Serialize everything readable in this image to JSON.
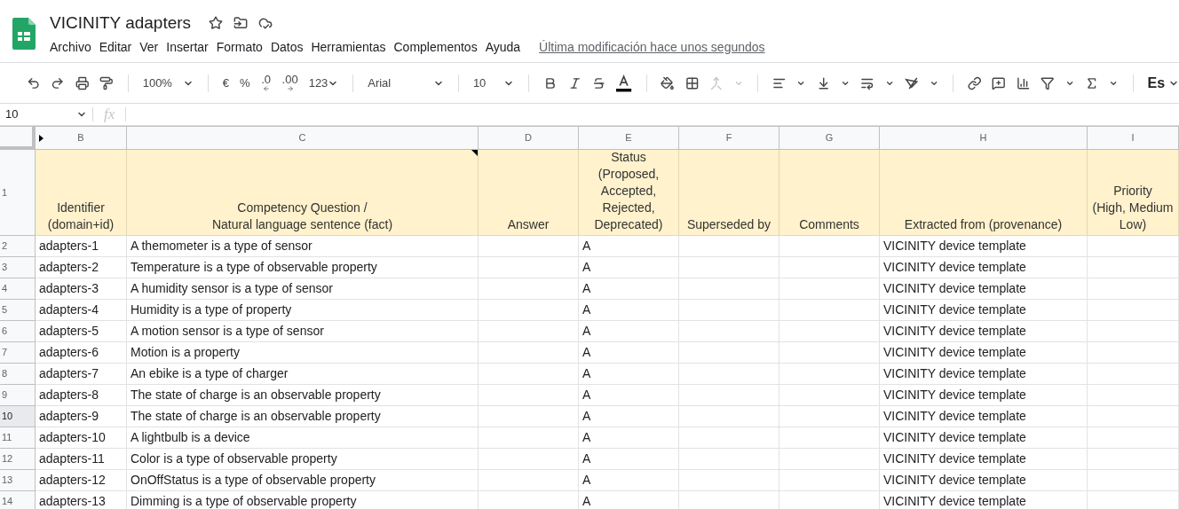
{
  "document": {
    "title": "VICINITY adapters"
  },
  "menu": [
    "Archivo",
    "Editar",
    "Ver",
    "Insertar",
    "Formato",
    "Datos",
    "Herramientas",
    "Complementos",
    "Ayuda"
  ],
  "last_edit": "Última modificación hace unos segundos",
  "toolbar": {
    "zoom": "100%",
    "currency": "€",
    "percent": "%",
    "decrease_decimals": ".0",
    "increase_decimals": ".00",
    "number_format": "123",
    "font": "Arial",
    "font_size": "10",
    "input_tools": "Es"
  },
  "name_box": "10",
  "formula_label": "fx",
  "columns": [
    {
      "label": "B",
      "header": [
        "Identifier",
        "(domain+id)"
      ],
      "note": false
    },
    {
      "label": "C",
      "header": [
        "Competency Question /",
        "Natural language sentence (fact)"
      ],
      "note": true
    },
    {
      "label": "D",
      "header": [
        "Answer"
      ],
      "note": false
    },
    {
      "label": "E",
      "header": [
        "Status",
        "(Proposed,",
        "Accepted,",
        "Rejected,",
        "Deprecated)"
      ],
      "note": false
    },
    {
      "label": "F",
      "header": [
        "Superseded by"
      ],
      "note": false
    },
    {
      "label": "G",
      "header": [
        "Comments"
      ],
      "note": false
    },
    {
      "label": "H",
      "header": [
        "Extracted from (provenance)"
      ],
      "note": false
    },
    {
      "label": "I",
      "header": [
        "Priority",
        "(High, Medium",
        "Low)"
      ],
      "note": false
    }
  ],
  "header_row_number": "1",
  "rows": [
    {
      "number": "2",
      "selected": false,
      "cells": {
        "B": "adapters-1",
        "C": "A themometer is a type of sensor",
        "E": "A",
        "H": "VICINITY device template"
      }
    },
    {
      "number": "3",
      "selected": false,
      "cells": {
        "B": "adapters-2",
        "C": "Temperature is a type of observable property",
        "E": "A",
        "H": "VICINITY device template"
      }
    },
    {
      "number": "4",
      "selected": false,
      "cells": {
        "B": "adapters-3",
        "C": "A humidity sensor is a type of sensor",
        "E": "A",
        "H": "VICINITY device template"
      }
    },
    {
      "number": "5",
      "selected": false,
      "cells": {
        "B": "adapters-4",
        "C": "Humidity is a type of property",
        "E": "A",
        "H": "VICINITY device template"
      }
    },
    {
      "number": "6",
      "selected": false,
      "cells": {
        "B": "adapters-5",
        "C": "A motion sensor is a type of sensor",
        "E": "A",
        "H": "VICINITY device template"
      }
    },
    {
      "number": "7",
      "selected": false,
      "cells": {
        "B": "adapters-6",
        "C": "Motion is a property",
        "E": "A",
        "H": "VICINITY device template"
      }
    },
    {
      "number": "8",
      "selected": false,
      "cells": {
        "B": "adapters-7",
        "C": "An ebike is a type of charger",
        "E": "A",
        "H": "VICINITY device template"
      }
    },
    {
      "number": "9",
      "selected": false,
      "cells": {
        "B": "adapters-8",
        "C": "The state of charge is an observable property",
        "E": "A",
        "H": "VICINITY device template"
      }
    },
    {
      "number": "10",
      "selected": true,
      "cells": {
        "B": "adapters-9",
        "C": "The state of charge is an observable property",
        "E": "A",
        "H": "VICINITY device template"
      }
    },
    {
      "number": "11",
      "selected": false,
      "cells": {
        "B": "adapters-10",
        "C": "A lightbulb is a device",
        "E": "A",
        "H": "VICINITY device template"
      }
    },
    {
      "number": "12",
      "selected": false,
      "cells": {
        "B": "adapters-11",
        "C": "Color is a type of observable property",
        "E": "A",
        "H": "VICINITY device template"
      }
    },
    {
      "number": "13",
      "selected": false,
      "cells": {
        "B": "adapters-12",
        "C": "OnOffStatus is a type of observable property",
        "E": "A",
        "H": "VICINITY device template"
      }
    },
    {
      "number": "14",
      "selected": false,
      "cells": {
        "B": "adapters-13",
        "C": "Dimming is a type of observable property",
        "E": "A",
        "H": "VICINITY device template"
      }
    }
  ]
}
